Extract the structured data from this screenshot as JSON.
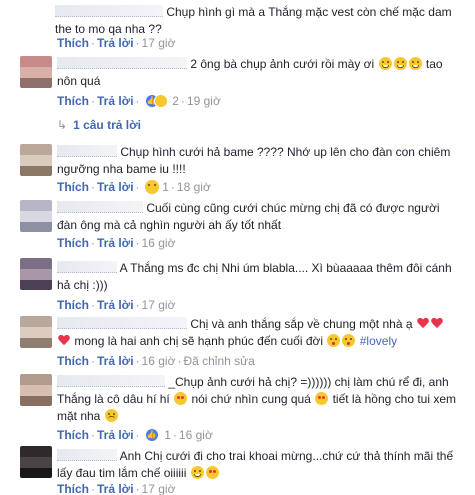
{
  "ui": {
    "like": "Thích",
    "reply": "Trả lời",
    "sep": "·",
    "edited": "Đã chỉnh sửa"
  },
  "comments": [
    {
      "text": "Chụp hình gì mà a Thắng mặc vest còn chế mặc dam the to mo qa nha ??",
      "time": "17 giờ",
      "reaction_count": "",
      "avatar_colors": [
        "#c9c2bb",
        "#d8cfc6",
        "#a7a09a"
      ]
    },
    {
      "text": "2 ông bà chụp ảnh cưới rồi mày ơi",
      "text2": "tao nôn quá",
      "time": "19 giờ",
      "reaction_count": "2",
      "avatar_colors": [
        "#c98a8a",
        "#d9b0a8",
        "#8f6f6c"
      ]
    },
    {
      "text": "Chụp hình cưới hả bame ???? Nhớ up lên cho đàn con chiêm ngưỡng nha bame iu !!!!",
      "time": "18 giờ",
      "reaction_count": "1",
      "avatar_colors": [
        "#bba89a",
        "#d9ccbe",
        "#8a7766"
      ]
    },
    {
      "text": "Cuối cùng cũng cưới chúc mừng chị đã có được người đàn ông mà cả nghìn người ah ấy tốt nhất",
      "time": "16 giờ",
      "reaction_count": "",
      "avatar_colors": [
        "#b7b6c7",
        "#d8d8e3",
        "#8e8fa3"
      ]
    },
    {
      "text": "A Thắng ms đc chị Nhi úm blabla.... Xì bùaaaaa thêm đôi cánh hả chị :)))",
      "time": "17 giờ",
      "reaction_count": "",
      "avatar_colors": [
        "#7d6e88",
        "#a897a8",
        "#4c4157"
      ]
    },
    {
      "text": "Chị và anh thắng sắp về chung một nhà ạ",
      "text2": "mong là hai anh chị sẽ hạnh phúc đến cuối đời",
      "hashtag": "#lovely",
      "time": "16 giờ",
      "reaction_count": "",
      "avatar_colors": [
        "#b8a79b",
        "#dccbbe",
        "#907e72"
      ]
    },
    {
      "text": "_Chụp ảnh cưới hả chị? =)))))) chị làm chú rể đi, anh Thắng là cô dâu hí hí",
      "text2": "nói chứ nhìn cung quá",
      "text3": "tiết là hồng cho tui xem mặt nha",
      "time": "16 giờ",
      "reaction_count": "1",
      "avatar_colors": [
        "#b29a8d",
        "#d4bfb1",
        "#8a6f61"
      ]
    },
    {
      "text": "Anh Chị cưới đi cho trai khoai mừng...chứ cứ thả thính mãi thế lấy đau tim lắm chế oiiiiii",
      "time": "17 giờ",
      "reaction_count": "",
      "avatar_colors": [
        "#2e2a2b",
        "#4a4446",
        "#1a1718"
      ]
    }
  ],
  "replies_link": "1 câu trả lời"
}
